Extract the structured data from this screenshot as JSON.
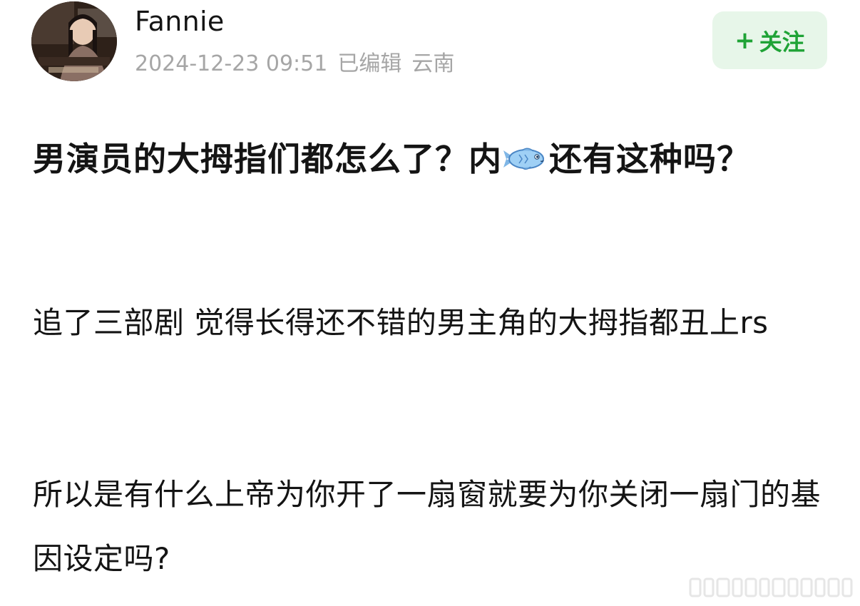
{
  "author": {
    "name": "Fannie",
    "avatar_icon": "user-avatar-photo"
  },
  "meta": {
    "timestamp": "2024-12-23 09:51",
    "edited": "已编辑",
    "location": "云南"
  },
  "follow": {
    "plus": "+",
    "label": "关注"
  },
  "post": {
    "title_before": "男演员的大拇指们都怎么了？内",
    "title_icon": "fish-emoji",
    "title_after": "还有这种吗？",
    "paragraphs": [
      "追了三部剧 觉得长得还不错的男主角的大拇指都丑上rs",
      "所以是有什么上帝为你开了一扇窗就要为你关闭一扇门的基因设定吗?"
    ]
  },
  "colors": {
    "accent_green": "#1fa336",
    "follow_bg": "#e7f6e9",
    "meta_gray": "#a6a6a6"
  }
}
